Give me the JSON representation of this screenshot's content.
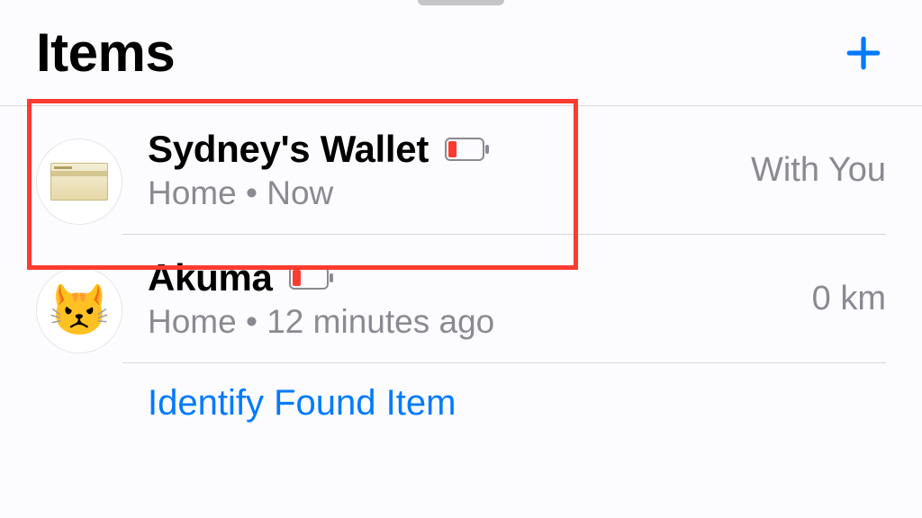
{
  "header": {
    "title": "Items"
  },
  "items": [
    {
      "name": "Sydney's Wallet",
      "location": "Home",
      "separator": "•",
      "time": "Now",
      "status": "With You",
      "iconType": "wallet",
      "batteryLow": true
    },
    {
      "name": "Akuma",
      "location": "Home",
      "separator": "•",
      "time": "12 minutes ago",
      "status": "0 km",
      "iconType": "cat",
      "emoji": "😾",
      "batteryLow": true
    }
  ],
  "identifyLabel": "Identify Found Item",
  "colors": {
    "accent": "#007aff",
    "highlight": "#ff3b30"
  }
}
